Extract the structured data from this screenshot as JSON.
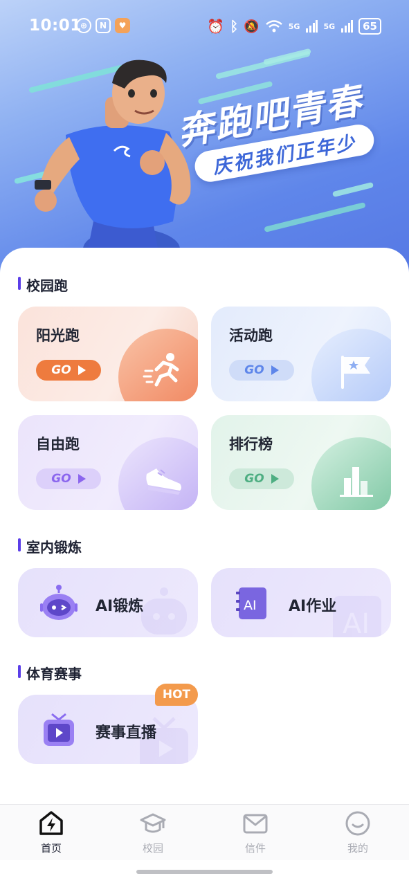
{
  "status_bar": {
    "time": "10:01",
    "left_icons": [
      "signal-circle-icon",
      "nfc-icon",
      "heart-app-icon"
    ],
    "right_icons": [
      "alarm-icon",
      "bluetooth-icon",
      "mute-icon",
      "wifi-icon"
    ],
    "network_1": "5G",
    "network_2": "5G",
    "battery": "65"
  },
  "banner": {
    "headline": "奔跑吧青春",
    "subline": "庆祝我们正年少"
  },
  "sections": {
    "campus": {
      "title": "校园跑",
      "cards": [
        {
          "label": "阳光跑",
          "go": "GO",
          "icon": "running-person-icon",
          "accent": "#f07a3f"
        },
        {
          "label": "活动跑",
          "go": "GO",
          "icon": "flag-star-icon",
          "accent": "#6f95f0"
        },
        {
          "label": "自由跑",
          "go": "GO",
          "icon": "sneaker-icon",
          "accent": "#9a7af0"
        },
        {
          "label": "排行榜",
          "go": "GO",
          "icon": "bar-chart-icon",
          "accent": "#5cb88f"
        }
      ]
    },
    "indoor": {
      "title": "室内锻炼",
      "items": [
        {
          "label": "AI锻炼",
          "icon": "robot-icon"
        },
        {
          "label": "AI作业",
          "icon": "ai-book-icon",
          "icon_text": "AI"
        }
      ]
    },
    "sports": {
      "title": "体育赛事",
      "items": [
        {
          "label": "赛事直播",
          "icon": "tv-play-icon",
          "badge": "HOT"
        }
      ]
    }
  },
  "tab_bar": {
    "items": [
      {
        "label": "首页",
        "icon": "home-bolt-icon",
        "active": true
      },
      {
        "label": "校园",
        "icon": "graduation-cap-icon",
        "active": false
      },
      {
        "label": "信件",
        "icon": "mail-icon",
        "active": false
      },
      {
        "label": "我的",
        "icon": "smile-face-icon",
        "active": false
      }
    ]
  }
}
